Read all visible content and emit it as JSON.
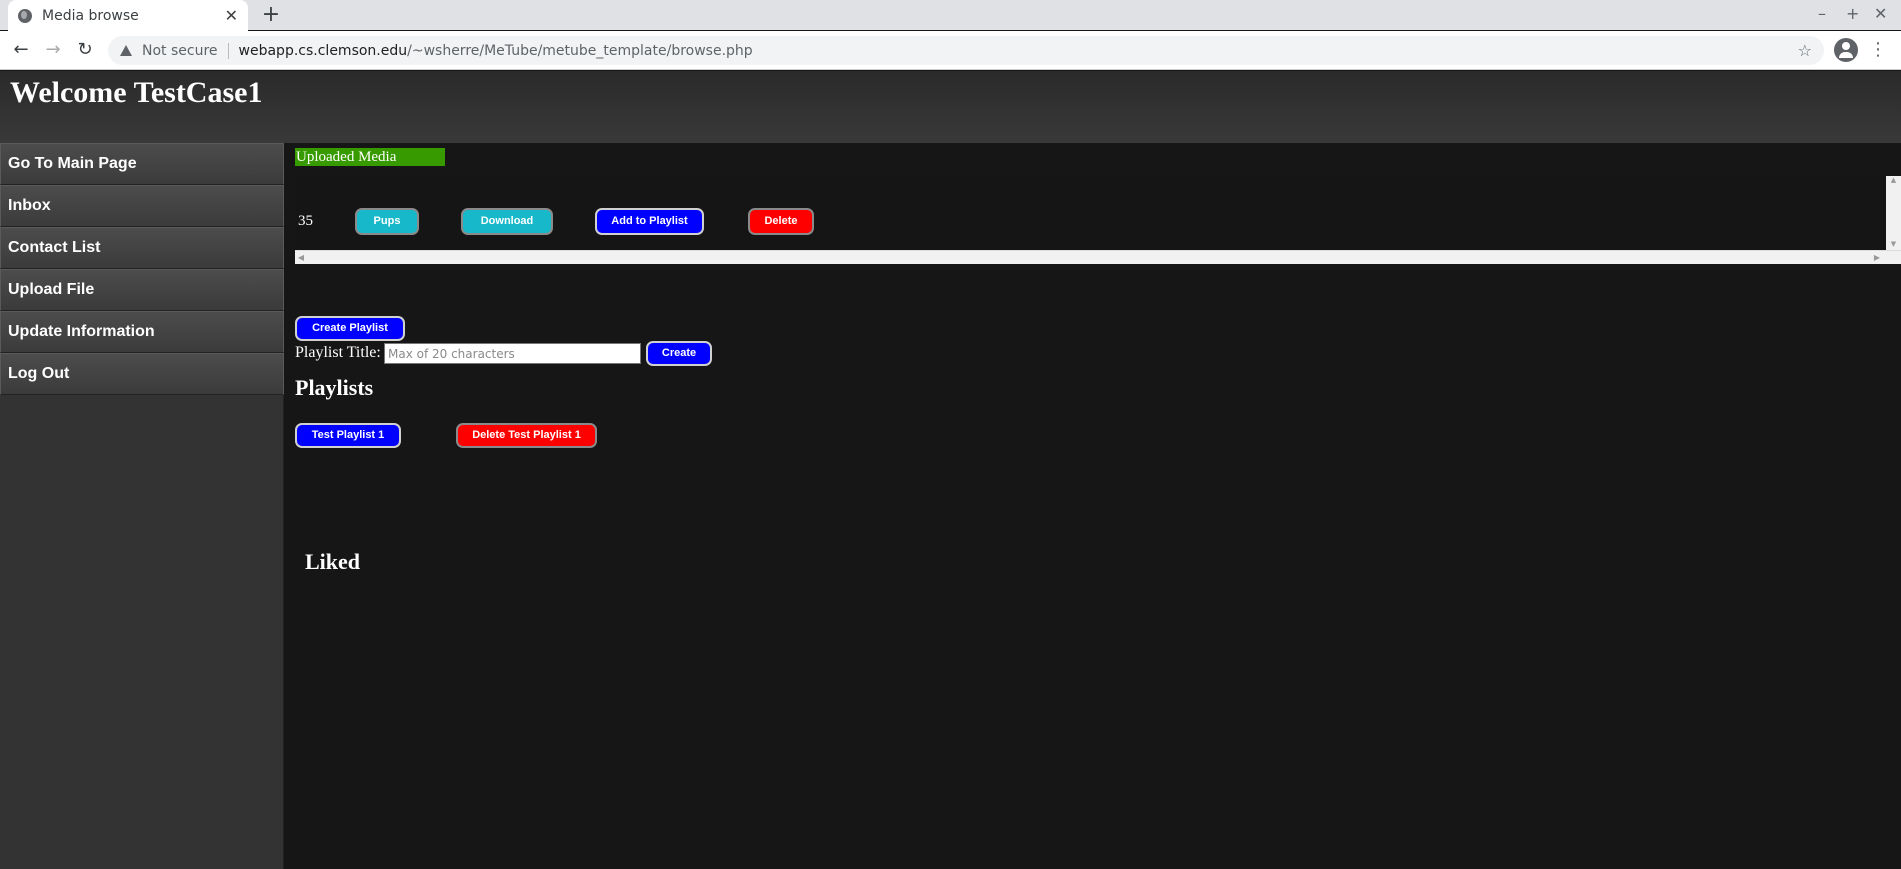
{
  "browser": {
    "tab_title": "Media browse",
    "tab_close": "✕",
    "new_tab": "+",
    "minimize": "–",
    "maximize": "+",
    "close": "✕",
    "back": "←",
    "forward": "→",
    "reload": "↻",
    "security_label": "Not secure",
    "url_host": "webapp.cs.clemson.edu",
    "url_path": "/~wsherre/MeTube/metube_template/browse.php",
    "bookmark": "☆",
    "menu": "⋮"
  },
  "header": {
    "welcome": "Welcome TestCase1"
  },
  "sidebar": {
    "items": [
      {
        "label": "Go To Main Page"
      },
      {
        "label": "Inbox"
      },
      {
        "label": "Contact List"
      },
      {
        "label": "Upload File"
      },
      {
        "label": "Update Information"
      },
      {
        "label": "Log Out"
      }
    ]
  },
  "main": {
    "uploaded_label": "Uploaded Media",
    "media_item": {
      "id": "35",
      "title_button": "Pups",
      "download_button": "Download",
      "add_playlist_button": "Add to Playlist",
      "delete_button": "Delete"
    },
    "create_playlist_button": "Create Playlist",
    "playlist_title_label": "Playlist Title:",
    "playlist_title_placeholder": "Max of 20 characters",
    "playlist_title_value": "",
    "create_button": "Create",
    "playlists_heading": "Playlists",
    "playlists": [
      {
        "name": "Test Playlist 1",
        "delete_label": "Delete Test Playlist 1"
      }
    ],
    "liked_heading": "Liked"
  },
  "colors": {
    "uploaded_bg": "#379b00",
    "teal_button": "#17b8c9",
    "blue_button": "#0000ff",
    "red_button": "#ff0000",
    "page_bg": "#161616"
  },
  "icons": [
    "globe-icon",
    "warning-icon",
    "star-icon",
    "account-icon",
    "menu-icon"
  ]
}
